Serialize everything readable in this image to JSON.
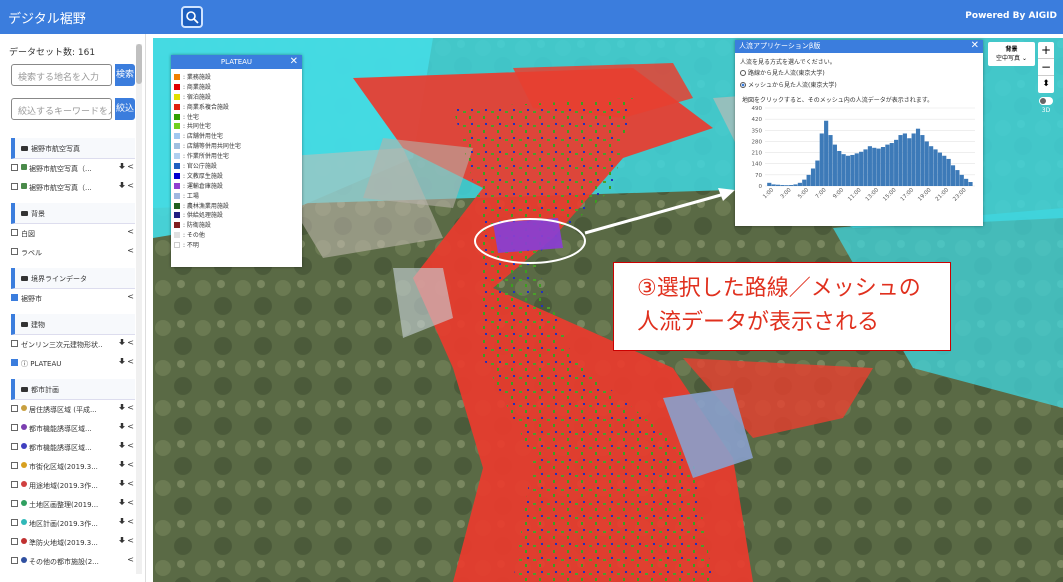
{
  "header": {
    "app_title": "デジタル裾野",
    "powered_by": "Powered By AIGID"
  },
  "sidebar": {
    "dataset_count": "データセット数: 161",
    "place_search_placeholder": "検索する地名を入力",
    "place_search_button": "検索",
    "keyword_placeholder": "絞込するキーワードを入力",
    "keyword_button": "絞込",
    "groups": [
      {
        "label": "裾野市航空写真",
        "items": [
          {
            "label": "裾野市航空写真（...",
            "checked": false,
            "icon": "image-icon",
            "download": true
          },
          {
            "label": "裾野市航空写真（...",
            "checked": false,
            "icon": "image-icon",
            "download": true
          }
        ]
      },
      {
        "label": "背景",
        "items": [
          {
            "label": "白図",
            "checked": false,
            "download": false
          },
          {
            "label": "ラベル",
            "checked": false,
            "download": false
          }
        ]
      },
      {
        "label": "境界ラインデータ",
        "items": [
          {
            "label": "裾野市",
            "checked": true,
            "download": false
          }
        ]
      },
      {
        "label": "建物",
        "items": [
          {
            "label": "ゼンリン三次元建物形状...",
            "checked": false,
            "download": true
          },
          {
            "label": "ⓘ PLATEAU",
            "checked": true,
            "download": true
          }
        ]
      },
      {
        "label": "都市計画",
        "items": [
          {
            "label": "居住誘導区域 (平成...",
            "checked": false,
            "dot": "#c8a040",
            "download": true
          },
          {
            "label": "都市機能誘導区域...",
            "checked": false,
            "dot": "#7b3fb0",
            "download": true
          },
          {
            "label": "都市機能誘導区域...",
            "checked": false,
            "dot": "#4040c0",
            "download": true
          },
          {
            "label": "市街化区域(2019.3...",
            "checked": false,
            "dot": "#d8a020",
            "download": true
          },
          {
            "label": "用途地域(2019.3作...",
            "checked": false,
            "dot": "#d04040",
            "download": true
          },
          {
            "label": "土地区画整理(2019...",
            "checked": false,
            "dot": "#30a060",
            "download": true
          },
          {
            "label": "地区計画(2019.3作...",
            "checked": false,
            "dot": "#30b8b8",
            "download": true
          },
          {
            "label": "準防火地域(2019.3...",
            "checked": false,
            "dot": "#c03030",
            "download": true
          },
          {
            "label": "その他の都市施設(2...",
            "checked": false,
            "dot": "#3050a0",
            "download": false
          }
        ]
      }
    ]
  },
  "legend": {
    "title": "PLATEAU",
    "items": [
      {
        "label": "業務施設",
        "color": "#f08000"
      },
      {
        "label": "商業施設",
        "color": "#e00000"
      },
      {
        "label": "宿泊施設",
        "color": "#e0e000"
      },
      {
        "label": "商業系複合施設",
        "color": "#e02010"
      },
      {
        "label": "住宅",
        "color": "#30a000"
      },
      {
        "label": "共同住宅",
        "color": "#70d020"
      },
      {
        "label": "店舗併用住宅",
        "color": "#a0c8f0"
      },
      {
        "label": "店舗等併用共同住宅",
        "color": "#a0c0e0"
      },
      {
        "label": "作業所併用住宅",
        "color": "#b0d0f0"
      },
      {
        "label": "官公庁施設",
        "color": "#2060c0"
      },
      {
        "label": "文教厚生施設",
        "color": "#0000d0"
      },
      {
        "label": "運輸倉庫施設",
        "color": "#9040d0"
      },
      {
        "label": "工場",
        "color": "#a0b8e0"
      },
      {
        "label": "農林漁業用施設",
        "color": "#206020"
      },
      {
        "label": "供給処理施設",
        "color": "#202080"
      },
      {
        "label": "防衛施設",
        "color": "#802020"
      },
      {
        "label": "その他",
        "color": "#e0e0e0"
      },
      {
        "label": "不明",
        "color": "#ffffff"
      }
    ]
  },
  "flow_panel": {
    "title": "人流アプリケーションβ版",
    "prompt": "人流を見る方式を選んでください。",
    "options": [
      {
        "label": "路線から見た人流(東京大学)",
        "selected": false
      },
      {
        "label": "メッシュから見た人流(東京大学)",
        "selected": true
      }
    ],
    "hint": "地図をクリックすると、そのメッシュ内の人流データが表示されます。",
    "chart_data": {
      "type": "bar",
      "y_ticks": [
        "490",
        "420",
        "350",
        "280",
        "210",
        "140",
        "70",
        "0"
      ],
      "ylim": [
        0,
        490
      ],
      "x_ticks": [
        "1:00",
        "3:00",
        "5:00",
        "7:00",
        "9:00",
        "11:00",
        "13:00",
        "15:00",
        "17:00",
        "19:00",
        "21:00",
        "23:00"
      ],
      "x": [
        0.5,
        1,
        1.5,
        2,
        2.5,
        3,
        3.5,
        4,
        4.5,
        5,
        5.5,
        6,
        6.5,
        7,
        7.5,
        8,
        8.5,
        9,
        9.5,
        10,
        10.5,
        11,
        11.5,
        12,
        12.5,
        13,
        13.5,
        14,
        14.5,
        15,
        15.5,
        16,
        16.5,
        17,
        17.5,
        18,
        18.5,
        19,
        19.5,
        20,
        20.5,
        21,
        21.5,
        22,
        22.5,
        23,
        23.5
      ],
      "values": [
        20,
        10,
        8,
        6,
        5,
        6,
        10,
        20,
        40,
        70,
        110,
        160,
        330,
        410,
        320,
        260,
        220,
        200,
        190,
        195,
        205,
        215,
        230,
        250,
        240,
        235,
        245,
        260,
        270,
        290,
        320,
        330,
        300,
        330,
        360,
        320,
        280,
        250,
        230,
        210,
        190,
        170,
        130,
        100,
        70,
        45,
        25
      ],
      "color": "#3d7ab8"
    }
  },
  "map_controls": {
    "background_label": "背景",
    "background_value": "空中写真",
    "zoom_in": "+",
    "zoom_out": "−",
    "compass": "⬍",
    "toggle_3d": "3D"
  },
  "callout": {
    "line1": "③選択した路線／メッシュの",
    "line2": "人流データが表示される"
  }
}
